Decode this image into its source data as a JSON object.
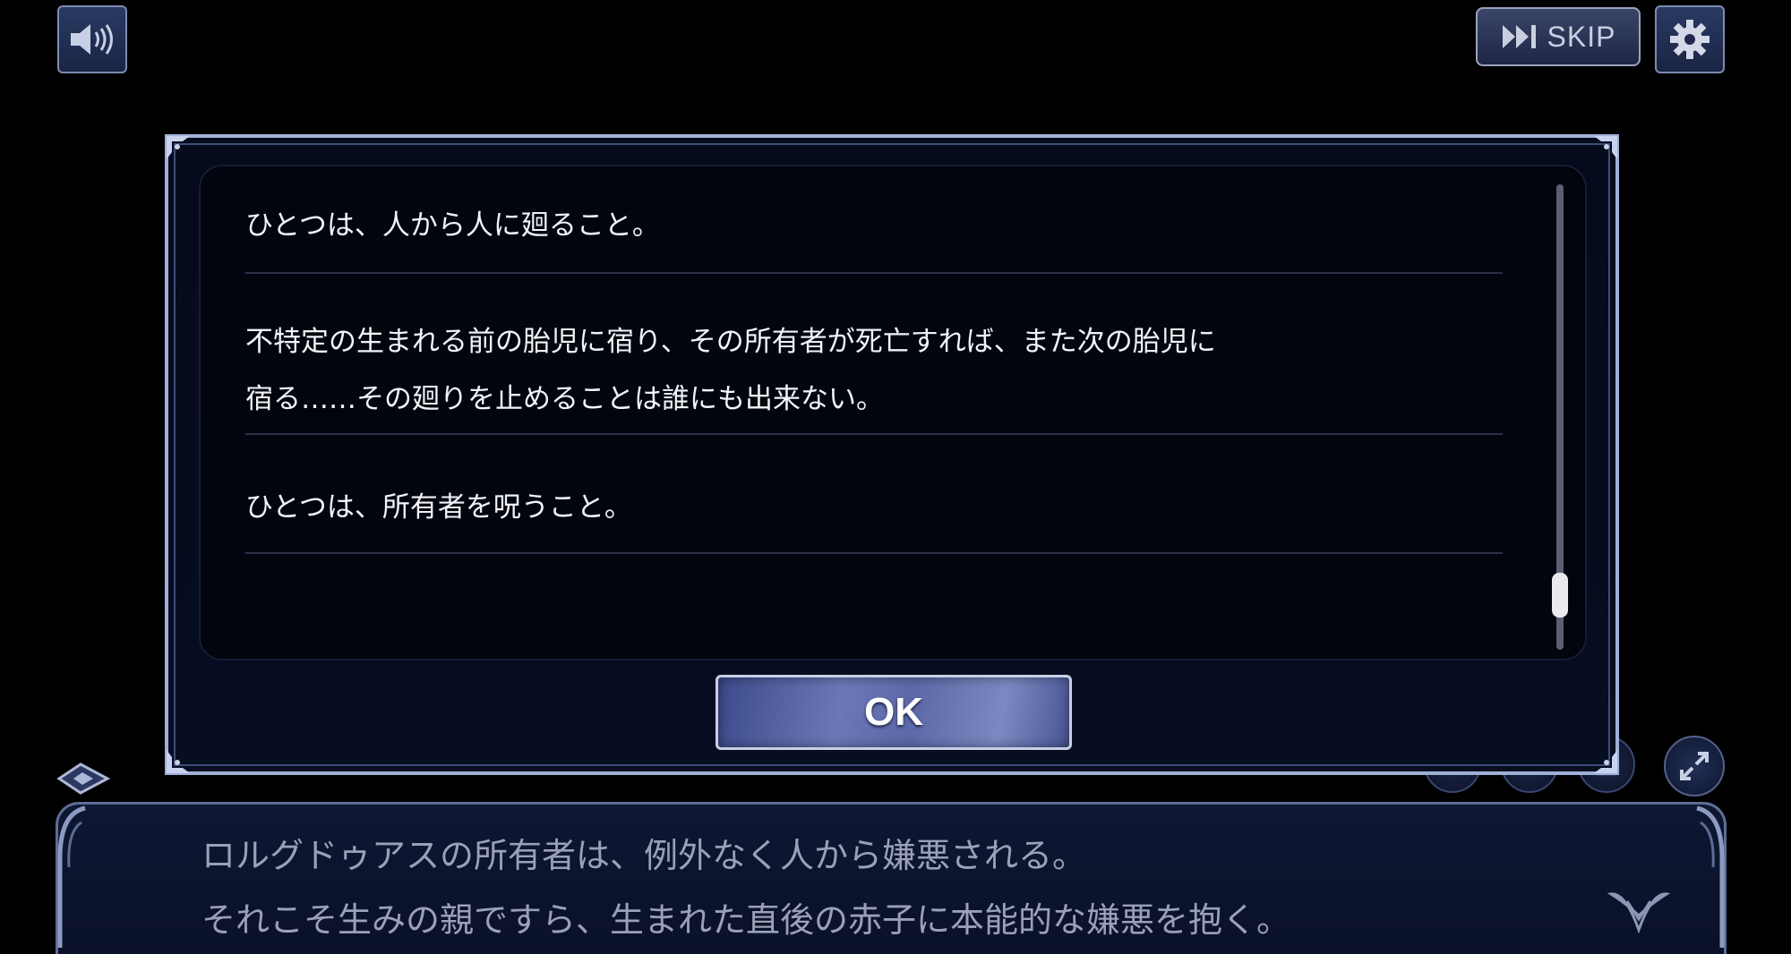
{
  "top_bar": {
    "sound_icon": "speaker-icon",
    "skip_label": "SKIP",
    "skip_icon": "skip-forward-icon",
    "settings_icon": "gear-icon"
  },
  "dialog": {
    "entries": [
      {
        "lines": [
          "ひとつは、人から人に廻ること。"
        ]
      },
      {
        "lines": [
          "不特定の生まれる前の胎児に宿り、その所有者が死亡すれば、また次の胎児に",
          "宿る……その廻りを止めることは誰にも出来ない。"
        ]
      },
      {
        "lines": [
          "ひとつは、所有者を呪うこと。"
        ]
      }
    ],
    "ok_label": "OK"
  },
  "message_window": {
    "lines": [
      "ロルグドゥアスの所有者は、例外なく人から嫌悪される。",
      "それこそ生みの親ですら、生まれた直後の赤子に本能的な嫌悪を抱く。"
    ]
  },
  "controls": {
    "icons": [
      "auto-play-icon",
      "play-icon",
      "log-icon",
      "fullscreen-icon"
    ]
  },
  "colors": {
    "dialog_border": "#9fb0d6",
    "ok_button": "#6b78b6",
    "message_window": "#0e1733",
    "text": "#f2f3f8"
  }
}
